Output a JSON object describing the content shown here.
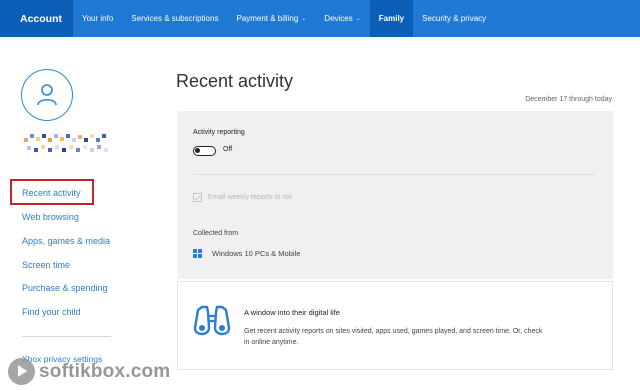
{
  "topnav": {
    "account": "Account",
    "your_info": "Your info",
    "services": "Services & subscriptions",
    "payment": "Payment & billing",
    "devices": "Devices",
    "family": "Family",
    "security": "Security & privacy"
  },
  "sidebar": {
    "items": [
      "Recent activity",
      "Web browsing",
      "Apps, games & media",
      "Screen time",
      "Purchase & spending",
      "Find your child"
    ],
    "selected": "Recent activity",
    "xbox": "Xbox privacy settings"
  },
  "main": {
    "title": "Recent activity",
    "date_range": "December 17 through today",
    "activity_reporting_label": "Activity reporting",
    "toggle_state": "Off",
    "email_weekly_label": "Email weekly reports to me",
    "collected_from_label": "Collected from",
    "devices_text": "Windows 10 PCs & Mobile"
  },
  "info_card": {
    "title": "A window into their digital life",
    "description": "Get recent activity reports on sites visited, apps used, games played, and screen time. Or, check in online anytime."
  },
  "watermark": {
    "text": "softikbox.com"
  },
  "colors": {
    "nav_bg": "#1e78d4",
    "nav_active": "#0c5fb6",
    "link": "#2c7fcf",
    "highlight_box": "#c0282e",
    "panel_bg": "#f0f0f0"
  },
  "icons": {
    "avatar": "user-icon",
    "devices": "windows-logo-icon",
    "card": "binoculars-icon"
  }
}
